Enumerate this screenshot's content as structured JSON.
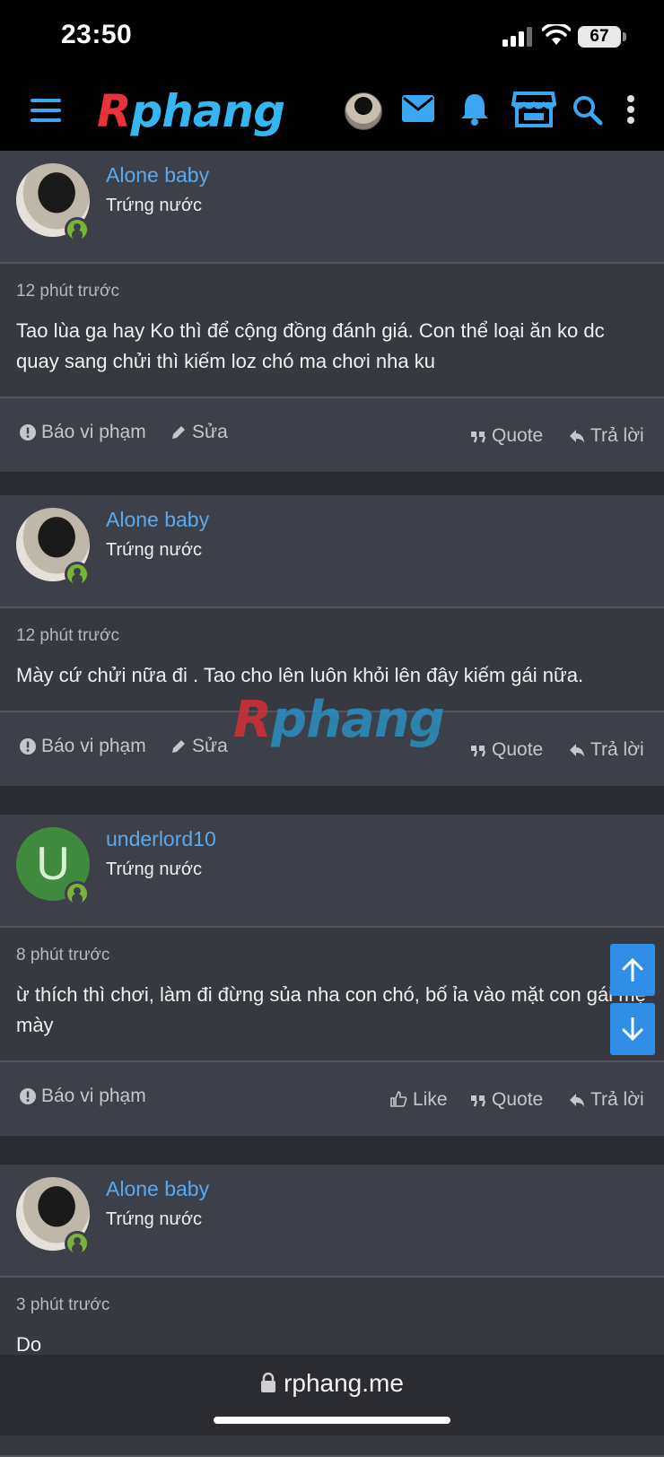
{
  "status_bar": {
    "time": "23:50",
    "battery": "67"
  },
  "navbar": {
    "logo_r": "R",
    "logo_rest": "phang"
  },
  "watermark": {
    "r": "R",
    "rest": "phang"
  },
  "posts": [
    {
      "username": "Alone baby",
      "rank": "Trứng nước",
      "time": "12 phút trước",
      "text": "Tao lùa ga hay Ko thì để cộng đồng đánh giá. Con thể loại ăn ko dc quay sang chửi thì kiếm loz chó ma chơi nha ku",
      "actions": {
        "report": "Báo vi phạm",
        "edit": "Sửa",
        "quote": "Quote",
        "reply": "Trả lời"
      }
    },
    {
      "username": "Alone baby",
      "rank": "Trứng nước",
      "time": "12 phút trước",
      "text": "Mày cứ chửi nữa đi . Tao cho lên luôn khỏi lên đây kiếm gái nữa.",
      "actions": {
        "report": "Báo vi phạm",
        "edit": "Sửa",
        "quote": "Quote",
        "reply": "Trả lời"
      }
    },
    {
      "username": "underlord10",
      "avatar_letter": "U",
      "rank": "Trứng nước",
      "time": "8 phút trước",
      "text": "ừ thích thì chơi, làm đi đừng sủa nha con chó, bố ỉa vào mặt con gái mẹ mày",
      "actions": {
        "report": "Báo vi phạm",
        "like": "Like",
        "quote": "Quote",
        "reply": "Trả lời"
      }
    },
    {
      "username": "Alone baby",
      "rank": "Trứng nước",
      "time": "3 phút trước",
      "text": "Do"
    }
  ],
  "browser": {
    "url": "rphang.me"
  }
}
